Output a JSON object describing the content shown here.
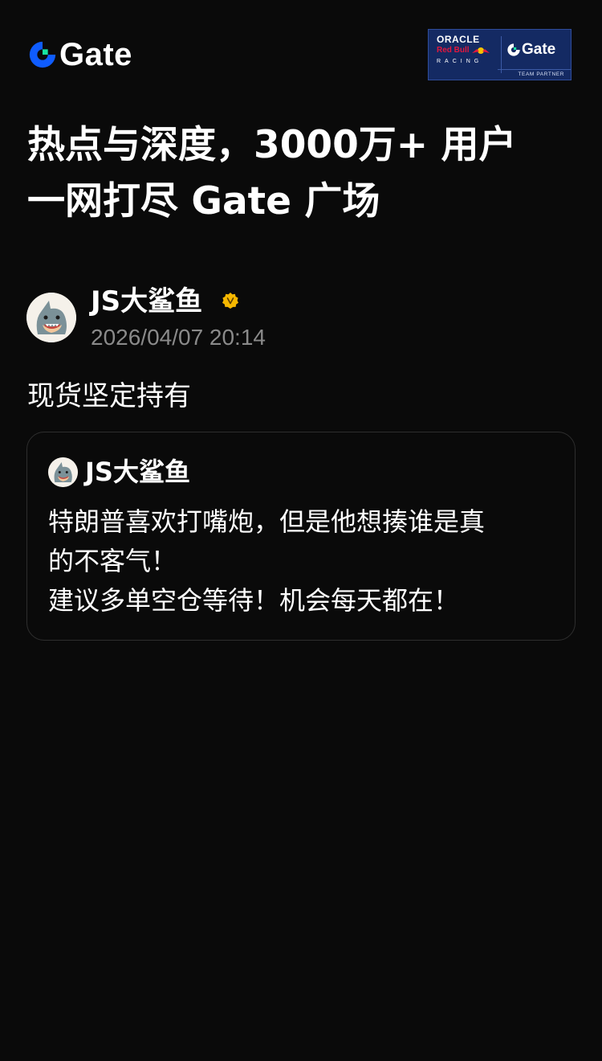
{
  "header": {
    "logo_text": "Gate",
    "partner_badge": {
      "line1": "ORACLE",
      "line2": "Red Bull",
      "line3": "RACING",
      "gate_text": "Gate",
      "caption": "TEAM PARTNER"
    }
  },
  "headline": {
    "line1": "热点与深度，3000万+ 用户",
    "line2": "一网打尽 Gate 广场"
  },
  "post": {
    "author": "JS大鲨鱼",
    "verified_icon": "verified-badge-icon",
    "timestamp": "2026/04/07 20:14",
    "text": "现货坚定持有"
  },
  "quoted_post": {
    "author": "JS大鲨鱼",
    "lines": [
      "特朗普喜欢打嘴炮，但是他想揍谁是真",
      "的不客气！",
      "建议多单空仓等待！机会每天都在！"
    ]
  },
  "colors": {
    "background": "#0a0a0a",
    "brand_blue": "#0f5cff",
    "brand_green": "#17e5a1",
    "badge_navy": "#142a63",
    "verified_gold": "#f5b700",
    "timestamp_gray": "#8a8a8a",
    "card_border": "#2e2e2e"
  }
}
